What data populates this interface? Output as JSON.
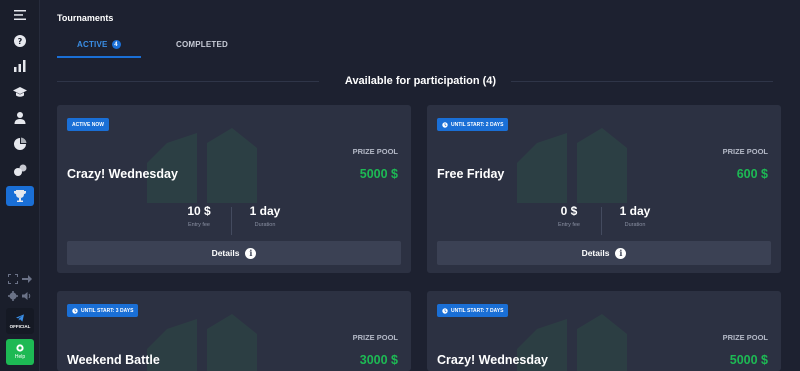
{
  "sidebar": {
    "items": [
      {
        "icon": "menu-icon"
      },
      {
        "icon": "question-icon"
      },
      {
        "icon": "bar-chart-icon"
      },
      {
        "icon": "graduation-cap-icon"
      },
      {
        "icon": "user-icon"
      },
      {
        "icon": "pie-chart-icon"
      },
      {
        "icon": "coins-icon"
      },
      {
        "icon": "trophy-icon",
        "active": true
      }
    ],
    "official_label": "OFFICIAL",
    "help_label": "Help"
  },
  "page": {
    "title": "Tournaments"
  },
  "tabs": {
    "active_label": "ACTIVE",
    "active_count": "4",
    "completed_label": "COMPLETED"
  },
  "section": {
    "title": "Available for participation (4)"
  },
  "cards": [
    {
      "badge": "ACTIVE NOW",
      "name": "Crazy! Wednesday",
      "prize_label": "PRIZE POOL",
      "prize": "5000 $",
      "entry_fee": "10 $",
      "entry_fee_label": "Entry fee",
      "duration": "1 day",
      "duration_label": "Duration",
      "details_label": "Details"
    },
    {
      "badge": "UNTIL START: 2 DAYS",
      "name": "Free Friday",
      "prize_label": "PRIZE POOL",
      "prize": "600 $",
      "entry_fee": "0 $",
      "entry_fee_label": "Entry fee",
      "duration": "1 day",
      "duration_label": "Duration",
      "details_label": "Details"
    },
    {
      "badge": "UNTIL START: 3 DAYS",
      "name": "Weekend Battle",
      "prize_label": "PRIZE POOL",
      "prize": "3000 $"
    },
    {
      "badge": "UNTIL START: 7 DAYS",
      "name": "Crazy! Wednesday",
      "prize_label": "PRIZE POOL",
      "prize": "5000 $"
    }
  ],
  "colors": {
    "accent": "#1a6fd6",
    "prize": "#1db954",
    "background": "#1d2130",
    "card": "#2c3142"
  }
}
